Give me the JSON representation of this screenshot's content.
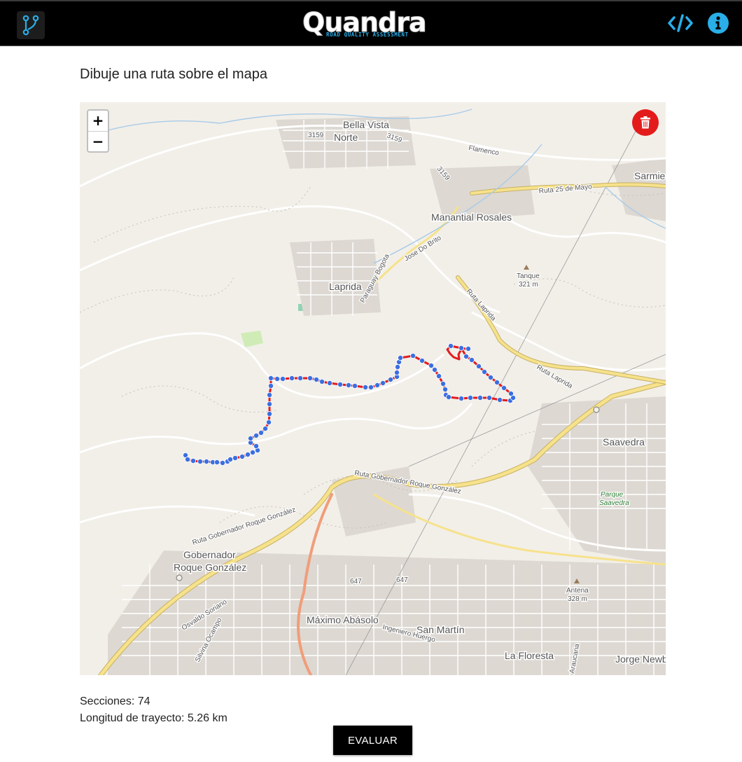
{
  "header": {
    "logo_text": "Quandra",
    "logo_subtitle": "ROAD QUALITY ASSESSMENT",
    "route_icon": "route-branch-icon",
    "code_icon": "code-icon",
    "info_icon": "info-circle-icon",
    "accent_color": "#29aee8"
  },
  "page": {
    "title": "Dibuje una ruta sobre el mapa"
  },
  "map": {
    "zoom_in": "+",
    "zoom_out": "−",
    "delete_icon": "trash-icon",
    "delete_color": "#e41b1b",
    "route_color": "#e41b1b",
    "marker_color": "#3b6fe0",
    "labels": {
      "bella_vista": "Bella Vista",
      "norte": "Norte",
      "sarmiento": "Sarmie",
      "manantial": "Manantial Rosales",
      "laprida": "Laprida",
      "tanque": "Tanque",
      "tanque_alt": "321 m",
      "saavedra": "Saavedra",
      "parque": "Parque",
      "parque2": "Saavedra",
      "gobernador": "Gobernador",
      "roque": "Roque González",
      "antena": "Antena",
      "antena_alt": "328 m",
      "maximo": "Máximo Abásolo",
      "san_martin": "San Martín",
      "la_floresta": "La Floresta",
      "jorge": "Jorge Newb",
      "flamenco": "Flamenco",
      "ruta25": "Ruta 25 de Mayo",
      "jose": "Jose Do Brito",
      "paraguay": "Paraguay Bogota",
      "ruta_laprida": "Ruta Laprida",
      "ruta_laprida2": "Ruta Laprida",
      "ruta_gob1": "Ruta Gobernador Roque González",
      "ruta_gob2": "Ruta Gobernador Roque González",
      "osvaldo": "Osvaldo Soriano",
      "silvina": "Silvina Ocampo",
      "ingeniero": "Ingeniero Huergo",
      "araucaria": "Araucaria",
      "r3159a": "3159",
      "r3159b": "3159",
      "r3159c": "3159",
      "r647a": "647",
      "r647b": "647"
    }
  },
  "stats": {
    "sections_label": "Secciones:",
    "sections": "74",
    "length_label": "Longitud de trayecto:",
    "length": "5.26 km"
  },
  "actions": {
    "evaluate": "EVALUAR"
  }
}
